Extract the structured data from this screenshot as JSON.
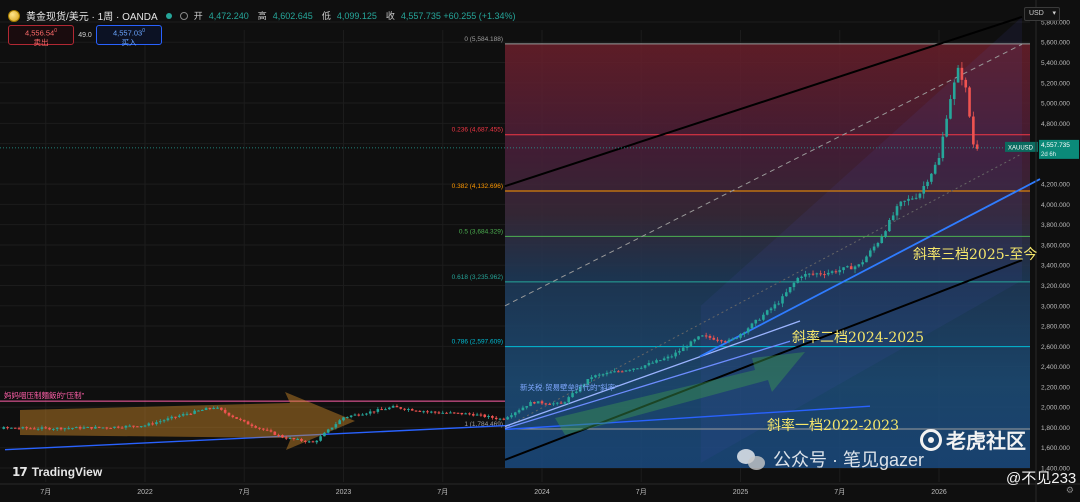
{
  "header": {
    "title": "黄金现货/美元 · 1周 · OANDA",
    "ohlc": [
      {
        "k": "开",
        "v": "4,472.240"
      },
      {
        "k": "高",
        "v": "4,602.645"
      },
      {
        "k": "低",
        "v": "4,099.125"
      },
      {
        "k": "收",
        "v": "4,557.735 +60.255 (+1.34%)"
      }
    ]
  },
  "trade": {
    "sell_price": "4,556.54",
    "sell_sup": "0",
    "sell_label": "卖出",
    "spread": "49.0",
    "buy_price": "4,557.03",
    "buy_sup": "0",
    "buy_label": "买入"
  },
  "currency": "USD",
  "branding": {
    "logo": "TradingView"
  },
  "price_axis": {
    "labels": [
      "5,800.000",
      "5,600.000",
      "5,400.000",
      "5,200.000",
      "5,000.000",
      "4,800.000",
      "4,600.000",
      "4,200.000",
      "4,000.000",
      "3,800.000",
      "3,600.000",
      "3,400.000",
      "3,200.000",
      "3,000.000",
      "2,800.000",
      "2,600.000",
      "2,400.000",
      "2,200.000",
      "2,000.000",
      "1,800.000",
      "1,600.000",
      "1,400.000"
    ],
    "values": [
      5800,
      5600,
      5400,
      5200,
      5000,
      4800,
      4600,
      4200,
      4000,
      3800,
      3600,
      3400,
      3200,
      3000,
      2800,
      2600,
      2400,
      2200,
      2000,
      1800,
      1600,
      1400
    ],
    "current_symbol": "XAUUSD",
    "current_price": "4,557.735",
    "current_countdown": "2d 6h",
    "current_value": 4557.735
  },
  "time_axis": {
    "labels": [
      "7月",
      "2022",
      "7月",
      "2023",
      "7月",
      "2024",
      "7月",
      "2025",
      "7月",
      "2026"
    ],
    "positions": [
      2021.5,
      2022,
      2022.5,
      2023,
      2023.5,
      2024,
      2024.5,
      2025,
      2025.5,
      2026
    ]
  },
  "fib_levels": [
    {
      "label": "0 (5,584.188)",
      "value": 5584.188,
      "color": "#9e9e9e"
    },
    {
      "label": "0.236 (4,687.455)",
      "value": 4687.455,
      "color": "#f23645"
    },
    {
      "label": "0.382 (4,132.696)",
      "value": 4132.696,
      "color": "#ff9800"
    },
    {
      "label": "0.5 (3,684.329)",
      "value": 3684.329,
      "color": "#4caf50"
    },
    {
      "label": "0.618 (3,235.962)",
      "value": 3235.962,
      "color": "#26a69a"
    },
    {
      "label": "0.786 (2,597.609)",
      "value": 2597.609,
      "color": "#00bcd4"
    },
    {
      "label": "1 (1,784.469)",
      "value": 1784.469,
      "color": "#9e9e9e"
    }
  ],
  "annotations": {
    "slope3": "斜率三档2025-至今",
    "slope2": "斜率二档2024-2025",
    "slope1": "斜率一档2022-2023",
    "suppress": "妈妈咽压制麵飯的\"压制\"",
    "new_relation": "新关税·贸易壁垒时代的\"斜率\""
  },
  "watermarks": {
    "wechat": "公众号 · 笔见gazer",
    "tiger": "老虎社区",
    "user": "@不见233"
  },
  "colors": {
    "up": "#26a69a",
    "down": "#ef5350",
    "accent_blue": "#2962ff",
    "annotation_yellow": "#f5e66b"
  },
  "icons": [
    "gold-coin-icon",
    "market-open-icon",
    "status-ring-icon",
    "chevron-down-icon",
    "gear-icon",
    "wechat-icon",
    "tiger-icon"
  ]
}
